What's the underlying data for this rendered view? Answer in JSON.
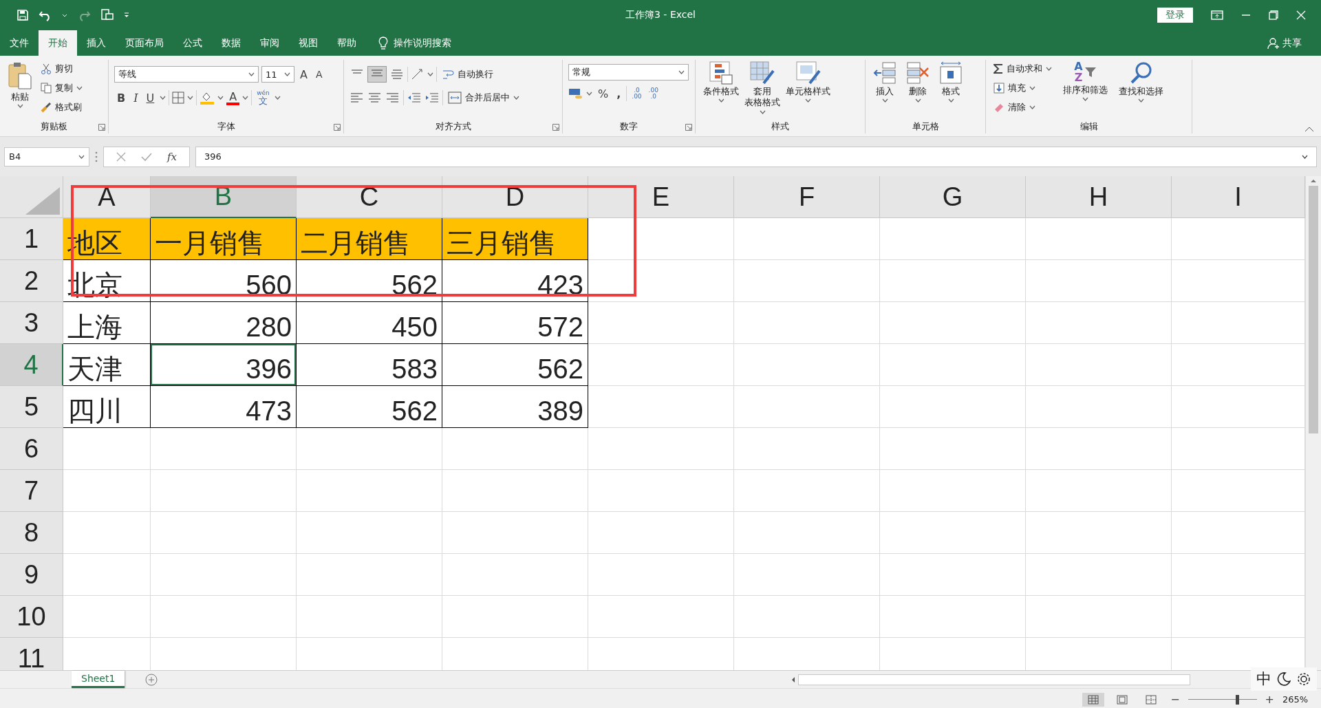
{
  "title_bar": {
    "title": "工作簿3  -  Excel",
    "sign_in": "登录"
  },
  "tabs": [
    {
      "label": "文件",
      "selected": false
    },
    {
      "label": "开始",
      "selected": true
    },
    {
      "label": "插入",
      "selected": false
    },
    {
      "label": "页面布局",
      "selected": false
    },
    {
      "label": "公式",
      "selected": false
    },
    {
      "label": "数据",
      "selected": false
    },
    {
      "label": "审阅",
      "selected": false
    },
    {
      "label": "视图",
      "selected": false
    },
    {
      "label": "帮助",
      "selected": false
    }
  ],
  "tell_me": "操作说明搜索",
  "share": "共享",
  "ribbon": {
    "clipboard": {
      "label": "剪贴板",
      "paste": "粘贴",
      "cut": "剪切",
      "copy": "复制",
      "format_painter": "格式刷"
    },
    "font": {
      "label": "字体",
      "font_name": "等线",
      "font_size": "11",
      "grow": "A",
      "shrink": "A",
      "bold": "B",
      "italic": "I",
      "underline": "U",
      "font_color": "A",
      "phonetic_top": "wén",
      "phonetic_bottom": "文"
    },
    "alignment": {
      "label": "对齐方式",
      "wrap_text": "自动换行",
      "merge": "合并后居中"
    },
    "number": {
      "label": "数字",
      "format": "常规",
      "percent": "%",
      "comma": ",",
      "increase_decimal": [
        ".0",
        ".00"
      ],
      "decrease_decimal": [
        ".00",
        ".0"
      ]
    },
    "styles": {
      "label": "样式",
      "conditional": "条件格式",
      "table": [
        "套用",
        "表格格式"
      ],
      "cell_styles": "单元格样式"
    },
    "cells": {
      "label": "单元格",
      "insert": "插入",
      "delete": "删除",
      "format": "格式"
    },
    "editing": {
      "label": "编辑",
      "autosum": "自动求和",
      "fill": "填充",
      "clear": "清除",
      "sort_letters": [
        "A",
        "Z"
      ],
      "sort": "排序和筛选",
      "find": "查找和选择"
    }
  },
  "formula_bar": {
    "name_box": "B4",
    "fx": "fx",
    "value": "396"
  },
  "sheet": {
    "columns": [
      {
        "label": "A",
        "selected": false
      },
      {
        "label": "B",
        "selected": true
      },
      {
        "label": "C",
        "selected": false
      },
      {
        "label": "D",
        "selected": false
      },
      {
        "label": "E",
        "selected": false
      },
      {
        "label": "F",
        "selected": false
      },
      {
        "label": "G",
        "selected": false
      },
      {
        "label": "H",
        "selected": false
      },
      {
        "label": "I",
        "selected": false
      }
    ],
    "rows": [
      {
        "label": "1",
        "selected": false,
        "cells": [
          {
            "text": "地区",
            "kind": "text",
            "color": "#ffc000",
            "selected": false
          },
          {
            "text": "一月销售",
            "kind": "text",
            "color": "#ffc000",
            "selected": false
          },
          {
            "text": "二月销售",
            "kind": "text",
            "color": "#ffc000",
            "selected": false
          },
          {
            "text": "三月销售",
            "kind": "text",
            "color": "#ffc000",
            "selected": false
          }
        ]
      },
      {
        "label": "2",
        "selected": false,
        "cells": [
          {
            "text": "北京",
            "kind": "text",
            "selected": false
          },
          {
            "text": "560",
            "kind": "number",
            "selected": false
          },
          {
            "text": "562",
            "kind": "number",
            "selected": false
          },
          {
            "text": "423",
            "kind": "number",
            "selected": false
          }
        ]
      },
      {
        "label": "3",
        "selected": false,
        "cells": [
          {
            "text": "上海",
            "kind": "text",
            "selected": false
          },
          {
            "text": "280",
            "kind": "number",
            "selected": false
          },
          {
            "text": "450",
            "kind": "number",
            "selected": false
          },
          {
            "text": "572",
            "kind": "number",
            "selected": false
          }
        ]
      },
      {
        "label": "4",
        "selected": true,
        "cells": [
          {
            "text": "天津",
            "kind": "text",
            "selected": false
          },
          {
            "text": "396",
            "kind": "number",
            "selected": true
          },
          {
            "text": "583",
            "kind": "number",
            "selected": false
          },
          {
            "text": "562",
            "kind": "number",
            "selected": false
          }
        ]
      },
      {
        "label": "5",
        "selected": false,
        "cells": [
          {
            "text": "四川",
            "kind": "text",
            "selected": false
          },
          {
            "text": "473",
            "kind": "number",
            "selected": false
          },
          {
            "text": "562",
            "kind": "number",
            "selected": false
          },
          {
            "text": "389",
            "kind": "number",
            "selected": false
          }
        ]
      },
      {
        "label": "6",
        "selected": false
      },
      {
        "label": "7",
        "selected": false
      },
      {
        "label": "8",
        "selected": false
      },
      {
        "label": "9",
        "selected": false
      },
      {
        "label": "10",
        "selected": false
      },
      {
        "label": "11",
        "selected": false
      }
    ]
  },
  "sheet_tabs": [
    {
      "label": "Sheet1",
      "selected": true
    }
  ],
  "ime": {
    "mode": "中"
  },
  "status_bar": {
    "views": [
      {
        "kind": "normal",
        "selected": true
      },
      {
        "kind": "page_layout",
        "selected": false
      },
      {
        "kind": "page_break",
        "selected": false
      }
    ],
    "zoom_out": "−",
    "zoom_in": "+",
    "zoom": "265%",
    "level": 0.72
  }
}
